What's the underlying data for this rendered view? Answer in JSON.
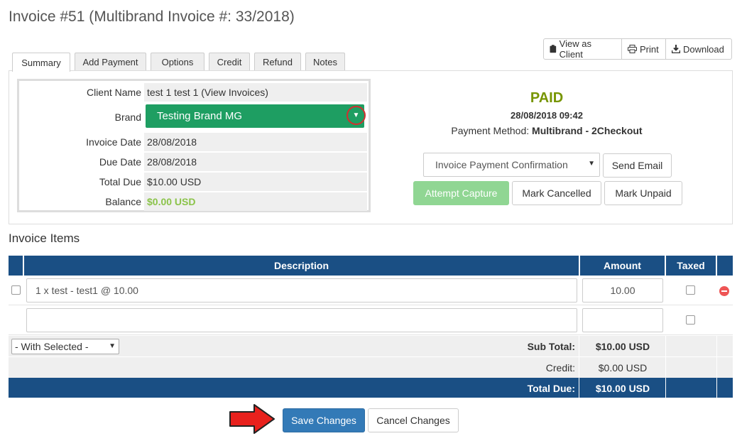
{
  "page": {
    "title": "Invoice #51 (Multibrand Invoice #: 33/2018)"
  },
  "top_actions": [
    {
      "icon": "clipboard-icon",
      "label": "View as Client"
    },
    {
      "icon": "print-icon",
      "label": "Print"
    },
    {
      "icon": "download-icon",
      "label": "Download"
    }
  ],
  "tabs": [
    {
      "label": "Summary",
      "active": true
    },
    {
      "label": "Add Payment"
    },
    {
      "label": "Options"
    },
    {
      "label": "Credit"
    },
    {
      "label": "Refund"
    },
    {
      "label": "Notes"
    }
  ],
  "summary": {
    "client_name_label": "Client Name",
    "client_name_value": "test 1 test 1 (View Invoices)",
    "brand_label": "Brand",
    "brand_value": "Testing Brand MG",
    "invoice_date_label": "Invoice Date",
    "invoice_date_value": "28/08/2018",
    "due_date_label": "Due Date",
    "due_date_value": "28/08/2018",
    "total_due_label": "Total Due",
    "total_due_value": "$10.00 USD",
    "balance_label": "Balance",
    "balance_value": "$0.00 USD"
  },
  "status": {
    "label": "PAID",
    "datetime": "28/08/2018 09:42",
    "method_label": "Payment Method:",
    "method_value": "Multibrand - 2Checkout"
  },
  "actions": {
    "email_template": "Invoice Payment Confirmation",
    "send_email": "Send Email",
    "attempt_capture": "Attempt Capture",
    "mark_cancelled": "Mark Cancelled",
    "mark_unpaid": "Mark Unpaid"
  },
  "items": {
    "heading": "Invoice Items",
    "columns": {
      "description": "Description",
      "amount": "Amount",
      "taxed": "Taxed"
    },
    "rows": [
      {
        "description": "1 x test - test1 @ 10.00",
        "amount": "10.00"
      },
      {
        "description": "",
        "amount": ""
      }
    ],
    "with_selected": "- With Selected -",
    "sub_total_label": "Sub Total:",
    "sub_total_value": "$10.00 USD",
    "credit_label": "Credit:",
    "credit_value": "$0.00 USD",
    "total_due_label": "Total Due:",
    "total_due_value": "$10.00 USD"
  },
  "footer": {
    "save": "Save Changes",
    "cancel": "Cancel Changes"
  },
  "colors": {
    "header_blue": "#1a4f84",
    "brand_green": "#1e9e62",
    "paid_green": "#779500",
    "balance_green": "#8bc34a",
    "save_blue": "#337ab7",
    "arrow_red": "#e8211d"
  }
}
